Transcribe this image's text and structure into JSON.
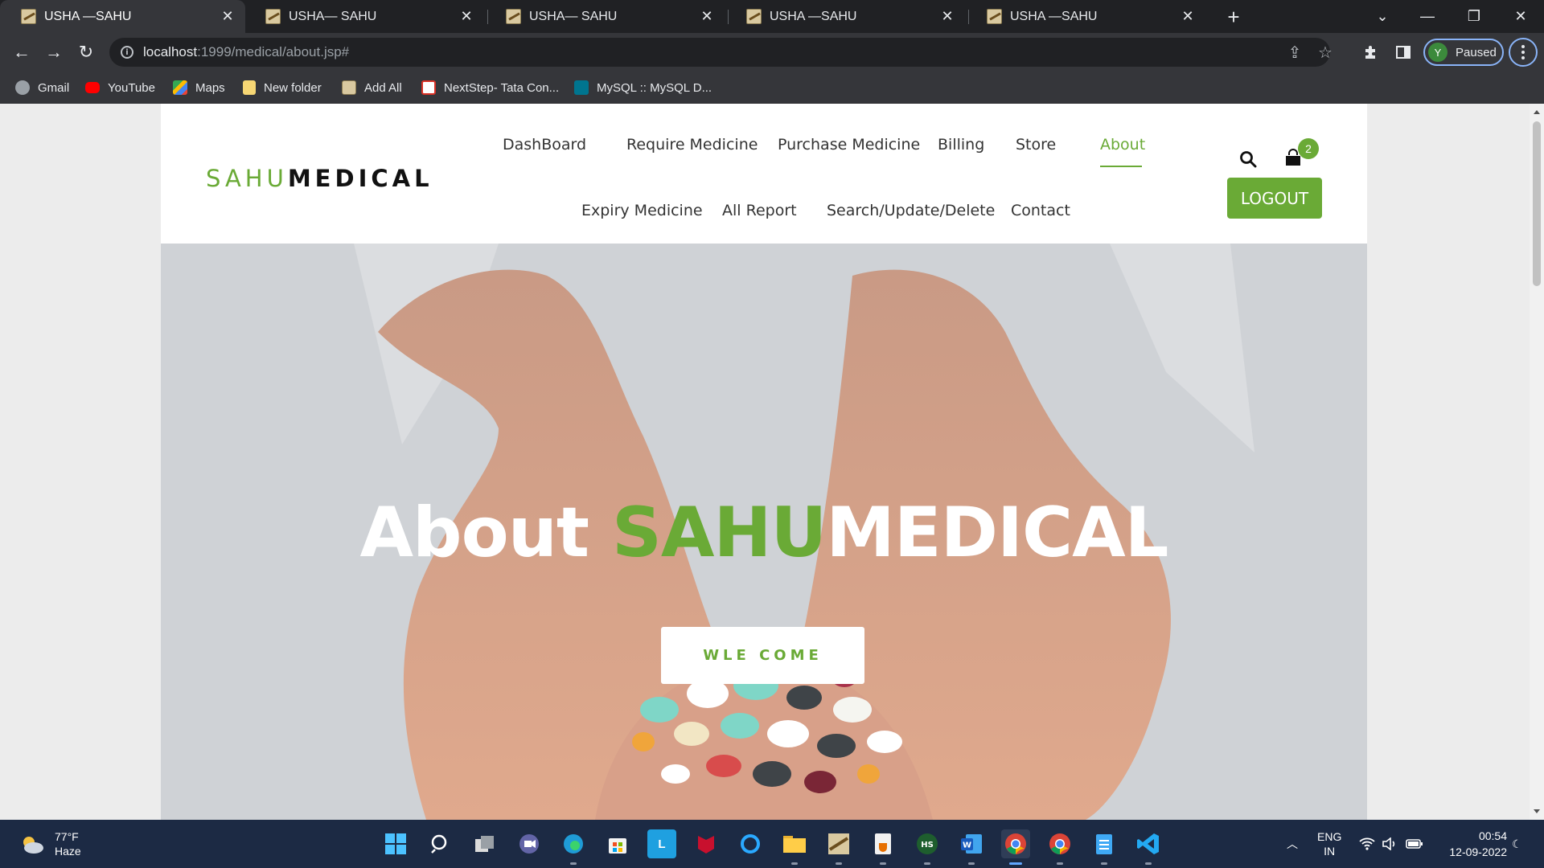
{
  "browser": {
    "tabs": [
      {
        "title": "USHA —SAHU",
        "active": true
      },
      {
        "title": "USHA— SAHU",
        "active": false
      },
      {
        "title": "USHA— SAHU",
        "active": false
      },
      {
        "title": "USHA —SAHU",
        "active": false
      },
      {
        "title": "USHA —SAHU",
        "active": false
      }
    ],
    "url_host": "localhost",
    "url_path": ":1999/medical/about.jsp#",
    "profile_initial": "Y",
    "profile_status": "Paused",
    "bookmarks": [
      {
        "label": "Gmail",
        "icon": "globe-icon"
      },
      {
        "label": "YouTube",
        "icon": "youtube-icon"
      },
      {
        "label": "Maps",
        "icon": "maps-icon"
      },
      {
        "label": "New folder",
        "icon": "folder-icon"
      },
      {
        "label": "Add All",
        "icon": "app-icon"
      },
      {
        "label": "NextStep- Tata Con...",
        "icon": "tcs-icon"
      },
      {
        "label": "MySQL :: MySQL D...",
        "icon": "mysql-icon"
      }
    ]
  },
  "site": {
    "logo_green": "SAHU",
    "logo_dark": "MEDICAL",
    "nav_top": [
      "DashBoard",
      "Require Medicine",
      "Purchase Medicine",
      "Billing",
      "Store",
      "About"
    ],
    "nav_bottom": [
      "Expiry Medicine",
      "All Report",
      "Search/Update/Delete",
      "Contact"
    ],
    "active_nav": "About",
    "cart_count": "2",
    "logout_label": "LOGOUT",
    "hero": {
      "title_white": "About ",
      "title_green": "SAHU",
      "title_end": "MEDICAL",
      "button_label": "WLE COME"
    },
    "colors": {
      "accent": "#6aaa36",
      "text": "#333333"
    }
  },
  "taskbar": {
    "weather_temp": "77°F",
    "weather_desc": "Haze",
    "lang_top": "ENG",
    "lang_bottom": "IN",
    "time": "00:54",
    "date": "12-09-2022"
  }
}
